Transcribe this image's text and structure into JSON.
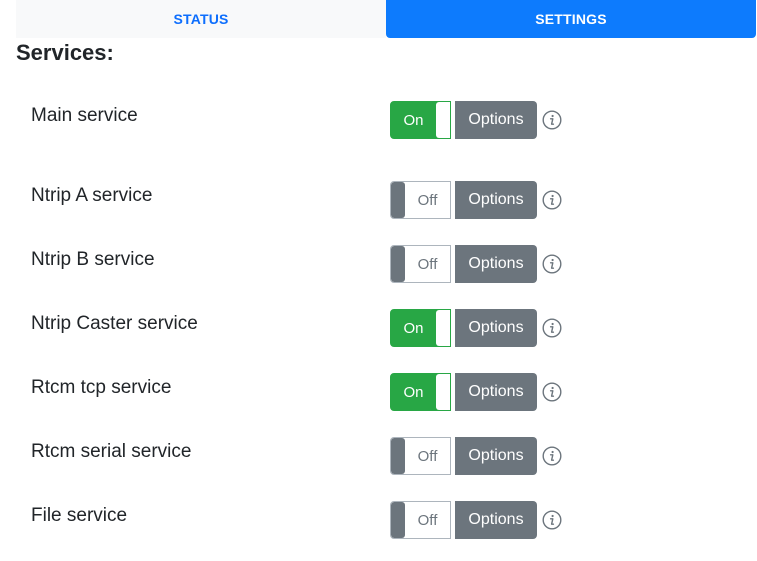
{
  "tabs": [
    {
      "label": "STATUS",
      "active": false
    },
    {
      "label": "SETTINGS",
      "active": true
    }
  ],
  "section_title": "Services:",
  "colors": {
    "accent": "#0d7bfd",
    "on": "#28a745",
    "secondary": "#6c757d"
  },
  "services": [
    {
      "label": "Main service",
      "state": "On",
      "options_label": "Options",
      "info_icon": "info-icon"
    },
    {
      "label": "Ntrip A service",
      "state": "Off",
      "options_label": "Options",
      "info_icon": "info-icon"
    },
    {
      "label": "Ntrip B service",
      "state": "Off",
      "options_label": "Options",
      "info_icon": "info-icon"
    },
    {
      "label": "Ntrip Caster service",
      "state": "On",
      "options_label": "Options",
      "info_icon": "info-icon"
    },
    {
      "label": "Rtcm tcp service",
      "state": "On",
      "options_label": "Options",
      "info_icon": "info-icon"
    },
    {
      "label": "Rtcm serial service",
      "state": "Off",
      "options_label": "Options",
      "info_icon": "info-icon"
    },
    {
      "label": "File service",
      "state": "Off",
      "options_label": "Options",
      "info_icon": "info-icon"
    }
  ]
}
